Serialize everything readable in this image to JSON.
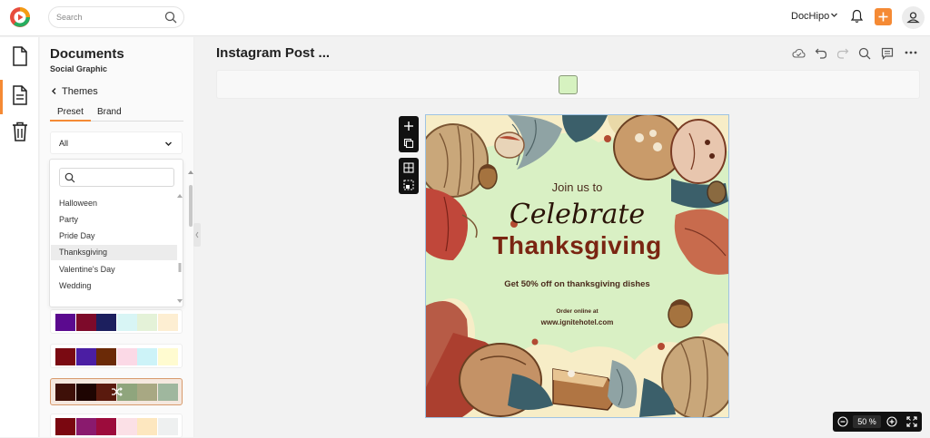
{
  "header": {
    "search_placeholder": "Search",
    "account_name": "DocHipo"
  },
  "panel": {
    "title": "Documents",
    "subtitle": "Social Graphic",
    "back_label": "Themes",
    "tabs": [
      {
        "label": "Preset",
        "active": true
      },
      {
        "label": "Brand",
        "active": false
      }
    ],
    "filter_value": "All",
    "dropdown_items": [
      {
        "label": "Halloween",
        "selected": false
      },
      {
        "label": "Party",
        "selected": false
      },
      {
        "label": "Pride Day",
        "selected": false
      },
      {
        "label": "Thanksgiving",
        "selected": true
      },
      {
        "label": "Valentine's Day",
        "selected": false
      },
      {
        "label": "Wedding",
        "selected": false
      }
    ],
    "palettes": [
      {
        "colors": [
          "#5b0a8f",
          "#7d0a2a",
          "#1c1f5e",
          "#d8f5f5",
          "#e4f2d8",
          "#fdeed2"
        ],
        "selected": false
      },
      {
        "colors": [
          "#7a0a12",
          "#4b1ea3",
          "#6b2a07",
          "#fbd9e6",
          "#cdf3f8",
          "#fffbd0"
        ],
        "selected": false
      },
      {
        "colors": [
          "#3e1008",
          "#1e0502",
          "#5a1a0e",
          "#8fa57d",
          "#a8a883",
          "#9fb79e"
        ],
        "selected": true
      },
      {
        "colors": [
          "#7a0710",
          "#8a1a6e",
          "#9c0c3c",
          "#fbe0e6",
          "#fde7bf",
          "#eef0f0"
        ],
        "selected": false
      }
    ]
  },
  "editor": {
    "document_title": "Instagram Post ...",
    "zoom_value": "50",
    "zoom_unit": "%"
  },
  "post": {
    "line1": "Join us to",
    "line2": "Celebrate",
    "line3": "Thanksgiving",
    "line4": "Get 50% off on thanksgiving dishes",
    "line5": "Order online at",
    "line6": "www.ignitehotel.com"
  },
  "colors": {
    "accent": "#f58a34",
    "post_background": "#d9f0c4",
    "headline": "#7a2512"
  }
}
